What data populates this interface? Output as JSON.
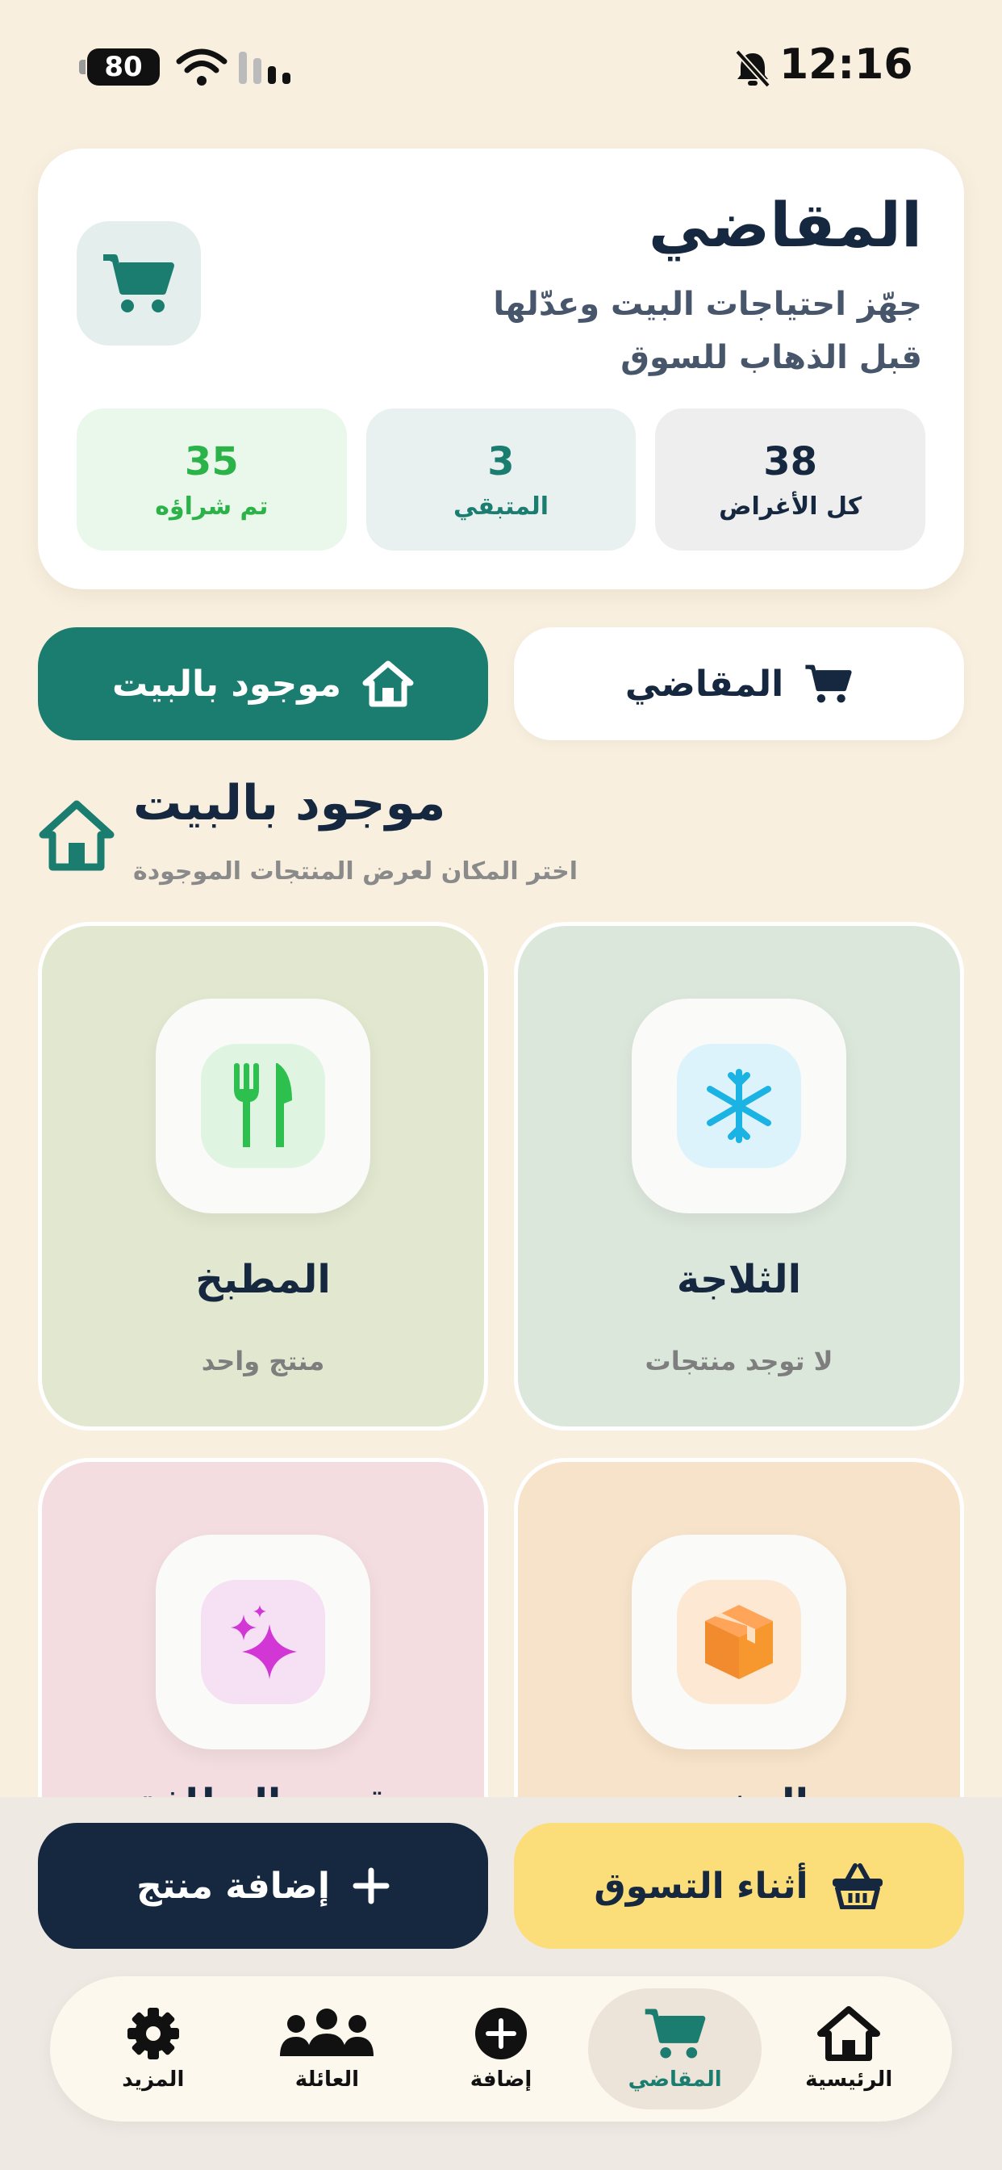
{
  "status_bar": {
    "time": "12:16",
    "battery": "80"
  },
  "summary": {
    "title": "المقاضي",
    "subtitle": "جهّز احتياجات البيت وعدّلها قبل الذهاب للسوق",
    "stats": [
      {
        "value": "38",
        "label": "كل الأغراض"
      },
      {
        "value": "3",
        "label": "المتبقي"
      },
      {
        "value": "35",
        "label": "تم شراؤه"
      }
    ]
  },
  "toggle": {
    "shopping_label": "المقاضي",
    "home_label": "موجود بالبيت",
    "selected": "home"
  },
  "section": {
    "title": "موجود بالبيت",
    "subtitle": "اختر المكان لعرض المنتجات الموجودة"
  },
  "locations": [
    {
      "name": "الثلاجة",
      "count": "لا توجد منتجات",
      "icon": "snowflake-icon"
    },
    {
      "name": "المطبخ",
      "count": "منتج واحد",
      "icon": "utensils-icon"
    },
    {
      "name": "المخزن",
      "count": "",
      "icon": "box-icon"
    },
    {
      "name": "قسم النظافة",
      "count": "",
      "icon": "sparkles-icon"
    }
  ],
  "actions": {
    "shopping_mode": "أثناء التسوق",
    "add_product": "إضافة منتج"
  },
  "tabbar": {
    "items": [
      {
        "label": "الرئيسية",
        "icon": "home-icon"
      },
      {
        "label": "المقاضي",
        "icon": "cart-icon"
      },
      {
        "label": "إضافة",
        "icon": "plus-circle-icon"
      },
      {
        "label": "العائلة",
        "icon": "family-icon"
      },
      {
        "label": "المزيد",
        "icon": "gear-icon"
      }
    ],
    "active": "المقاضي"
  },
  "colors": {
    "accent": "#1b7d70",
    "navy": "#162840",
    "yellow": "#fbdd7a",
    "background": "#f8efdf"
  }
}
